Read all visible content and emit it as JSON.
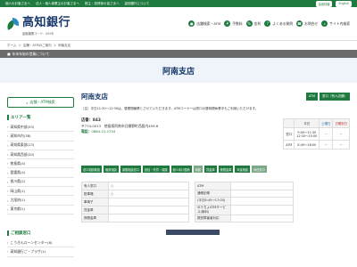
{
  "topbar": {
    "items": [
      "個人のお客さまへ",
      "法人・個人事業主のお客さまへ",
      "株主・投資家の皆さまへ",
      "高知銀行について"
    ],
    "right": [
      "採用情報",
      "English"
    ]
  },
  "header": {
    "bank_name": "高知銀行",
    "bank_code": "金融機関コード：0578",
    "nav": [
      {
        "icon": "pin-icon",
        "glyph": "●",
        "label": "店舗検索・ATM"
      },
      {
        "icon": "money-icon",
        "glyph": "¥",
        "label": "手数料"
      },
      {
        "icon": "percent-icon",
        "glyph": "%",
        "label": "金利"
      },
      {
        "icon": "question-icon",
        "glyph": "?",
        "label": "よくある質問"
      },
      {
        "icon": "phone-icon",
        "glyph": "☎",
        "label": "お問合せ"
      },
      {
        "icon": "search-icon",
        "glyph": "⌕",
        "label": "サイト内検索"
      }
    ]
  },
  "breadcrumb": {
    "items": [
      "ホーム",
      "店舗・ATMのご案内",
      "阿南支店"
    ]
  },
  "notice": {
    "text": "年末年始の営業について"
  },
  "page_title": "阿南支店",
  "sidebar": {
    "search_button": "店舗・ATM検索",
    "area_heading": "エリア一覧",
    "areas": [
      "高知県中部(53)",
      "高知市内(38)",
      "高知県東部(13)",
      "高知県西部(20)",
      "徳島県(4)",
      "愛媛県(4)",
      "香川県(2)",
      "岡山県(1)",
      "大阪府(1)",
      "東京都(1)"
    ],
    "guide_heading": "ご相談窓口",
    "guides": [
      "こうぎんローンセンター(6)",
      "高知銀行ご・プラザ(1)"
    ]
  },
  "branch": {
    "name": "阿南支店",
    "badges": [
      "ATM",
      "窓口（有人店舗）"
    ],
    "hours_note": "（注）平日11:30～12:30は、昼間閉鎖業とさせていただきます。ATMコーナーは窓口の昼時間休業中もご利用いただけます。",
    "code_line": "店番：843",
    "address": "〒774-0013　徳島県阿南市日開野町西居内459-6",
    "tel_label": "電話：",
    "tel": "0884-22-2704"
  },
  "hours": {
    "headers": [
      "",
      "平日",
      "土曜日",
      "日曜祝日"
    ],
    "rows": [
      {
        "label": "窓口",
        "weekday": "9:00～11:30\n12:30～15:00",
        "sat": "－",
        "sun": "－"
      },
      {
        "label": "ATM",
        "weekday": "8:45～18:00",
        "sat": "－",
        "sun": "－"
      }
    ]
  },
  "services": [
    {
      "label": "窓口相談取扱",
      "dim": false
    },
    {
      "label": "融資相談",
      "dim": false
    },
    {
      "label": "保険相談窓口",
      "dim": false
    },
    {
      "label": "投信・外貨・保険",
      "dim": false
    },
    {
      "label": "個人向け国債",
      "dim": false
    },
    {
      "label": "両替",
      "dim": true
    },
    {
      "label": "貸金庫",
      "dim": false
    },
    {
      "label": "夜間金庫",
      "dim": false
    },
    {
      "label": "年金相談",
      "dim": false
    },
    {
      "label": "休日窓口",
      "dim": true
    }
  ],
  "facilities_left": [
    {
      "k": "有人窓口",
      "v": "○"
    },
    {
      "k": "駐車場",
      "v": "○"
    },
    {
      "k": "車椅子",
      "v": ""
    },
    {
      "k": "貸金庫",
      "v": ""
    },
    {
      "k": "夜間金庫",
      "v": ""
    }
  ],
  "facilities_right": [
    {
      "k": "ATM",
      "v": ""
    },
    {
      "k": "通帳記帳",
      "v": ""
    },
    {
      "k": "(平日8:45～17:00)",
      "v": ""
    },
    {
      "k": "ゆうちょATMサービス(無料)",
      "v": ""
    },
    {
      "k": "視覚障害者対応",
      "v": ""
    }
  ],
  "colors": {
    "brand_green": "#1f7a3f",
    "navy": "#1a3a6c",
    "accent_blue": "#2b8cc4"
  }
}
